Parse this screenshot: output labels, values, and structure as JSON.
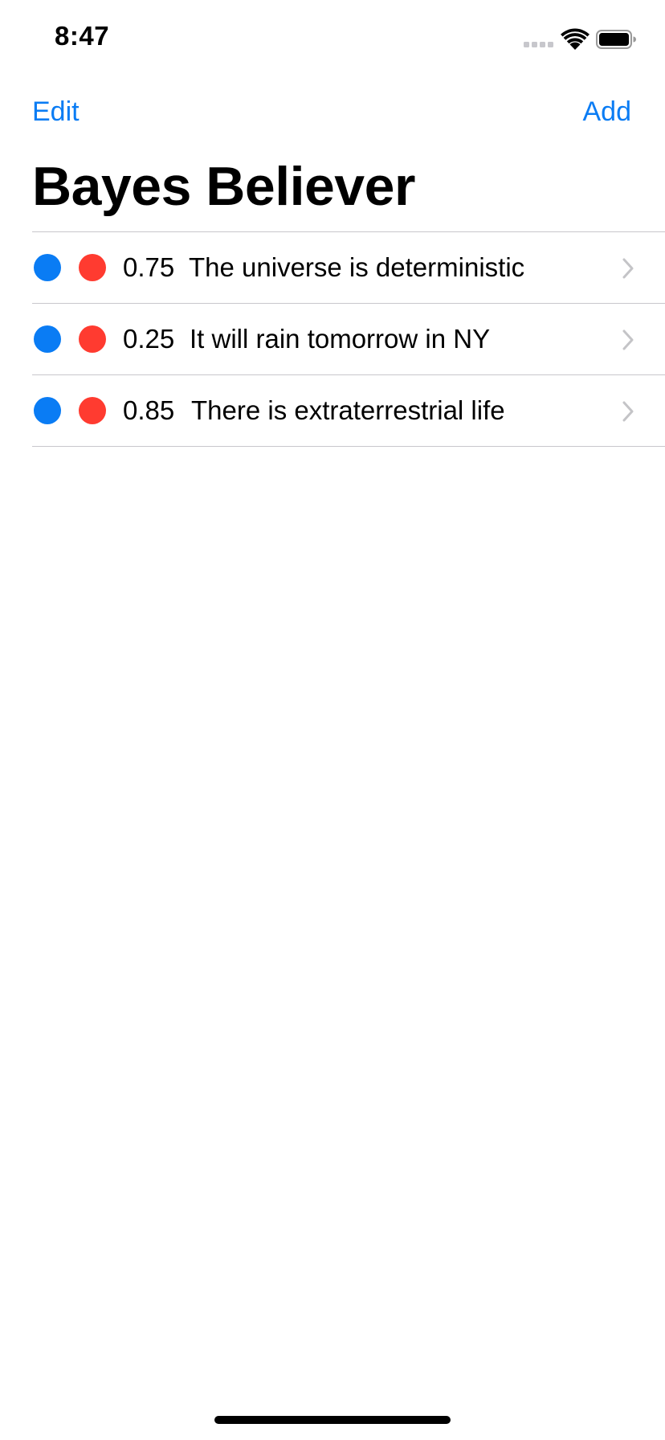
{
  "status_bar": {
    "time": "8:47",
    "icons": [
      "signal-icon",
      "wifi-icon",
      "battery-icon"
    ]
  },
  "nav": {
    "edit_label": "Edit",
    "add_label": "Add"
  },
  "title": "Bayes Believer",
  "beliefs": [
    {
      "value": "0.75",
      "text": "The universe is deterministic"
    },
    {
      "value": "0.25",
      "text": "It will rain tomorrow in NY"
    },
    {
      "value": "0.85",
      "text": "There is extraterrestrial life"
    }
  ],
  "colors": {
    "accent": "#0a7cf4",
    "blue_dot": "#0a7cf4",
    "red_dot": "#ff3b30",
    "separator": "#c8c7cc",
    "chevron": "#c4c4c7"
  }
}
